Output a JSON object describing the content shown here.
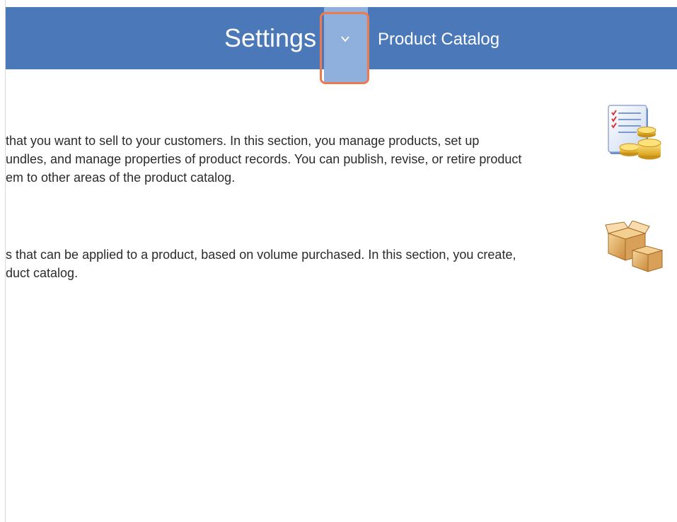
{
  "header": {
    "title": "Settings",
    "breadcrumb": "Product Catalog"
  },
  "sections": [
    {
      "icon": "price-list-coins-icon",
      "lines": [
        "that you want to sell to your customers. In this section, you manage products, set up",
        "undles, and manage properties of product records. You can publish, revise, or retire product",
        "em to other areas of the product catalog."
      ]
    },
    {
      "icon": "product-boxes-icon",
      "lines": [
        "s that can be applied to a product, based on volume purchased. In this section, you create,",
        "duct catalog."
      ]
    }
  ],
  "colors": {
    "header_bg": "#4a78b9",
    "dropdown_bg": "#8fb0dc",
    "highlight": "#ed7a4f"
  }
}
